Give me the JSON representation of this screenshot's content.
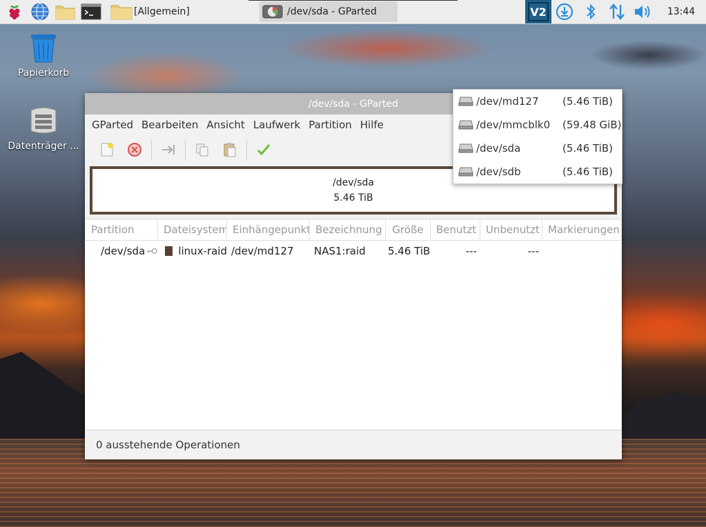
{
  "taskbar": {
    "folder_label": "[Allgemein]",
    "window_label": "/dev/sda - GParted",
    "clock": "13:44",
    "vnc_label": "V2"
  },
  "desktop": {
    "trash_label": "Papierkorb",
    "disks_label": "Datenträger ..."
  },
  "window": {
    "title": "/dev/sda - GParted",
    "menu": [
      "GParted",
      "Bearbeiten",
      "Ansicht",
      "Laufwerk",
      "Partition",
      "Hilfe"
    ],
    "diskmap": {
      "device": "/dev/sda",
      "size": "5.46 TiB"
    },
    "columns": [
      "Partition",
      "Dateisystem",
      "Einhängepunkt",
      "Bezeichnung",
      "Größe",
      "Benutzt",
      "Unbenutzt",
      "Markierungen"
    ],
    "rows": [
      {
        "partition": "/dev/sda",
        "filesystem": "linux-raid",
        "filesystem_color": "#5a4030",
        "mountpoint": "/dev/md127",
        "label": "NAS1:raid",
        "size": "5.46 TiB",
        "used": "---",
        "unused": "---",
        "flags": ""
      }
    ],
    "status": "0 ausstehende Operationen"
  },
  "device_dropdown": [
    {
      "name": "/dev/md127",
      "size": "(5.46 TiB)"
    },
    {
      "name": "/dev/mmcblk0",
      "size": "(59.48 GiB)"
    },
    {
      "name": "/dev/sda",
      "size": "(5.46 TiB)"
    },
    {
      "name": "/dev/sdb",
      "size": "(5.46 TiB)"
    }
  ],
  "colors": {
    "diskmap_border": "#5a4838",
    "apply_check": "#6cbf3a",
    "vnc_bg": "#1f5f8b",
    "tray_blue": "#2f8fd8"
  }
}
